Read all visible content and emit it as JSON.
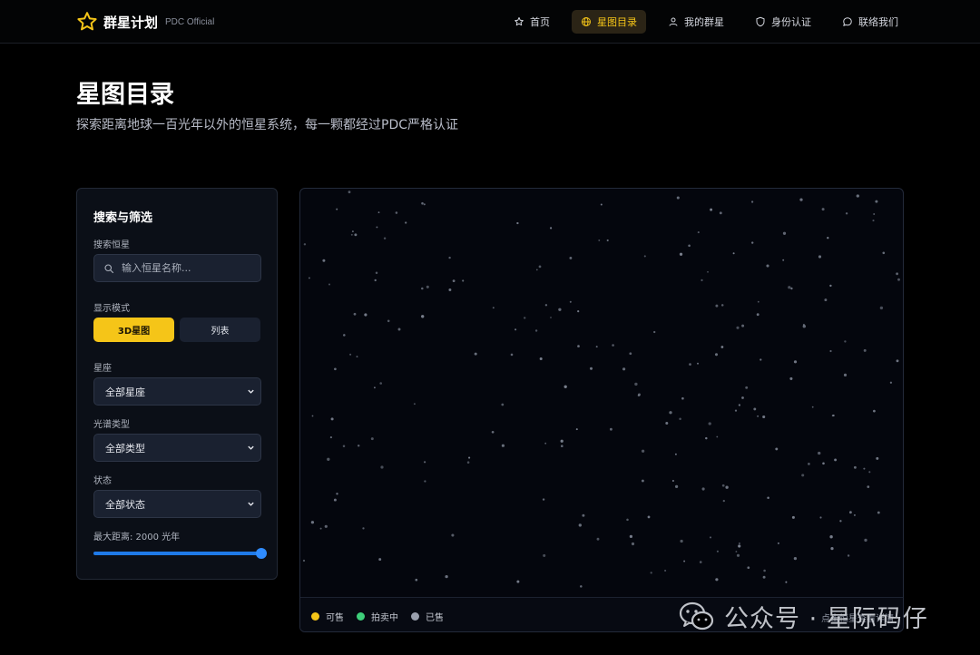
{
  "brand": {
    "name": "群星计划",
    "sub": "PDC Official",
    "accent": "#f5c518"
  },
  "nav": {
    "items": [
      {
        "label": "首页",
        "icon": "star-outline-icon",
        "active": false
      },
      {
        "label": "星图目录",
        "icon": "globe-icon",
        "active": true
      },
      {
        "label": "我的群星",
        "icon": "user-icon",
        "active": false
      },
      {
        "label": "身份认证",
        "icon": "shield-icon",
        "active": false
      },
      {
        "label": "联络我们",
        "icon": "chat-icon",
        "active": false
      }
    ]
  },
  "header": {
    "title": "星图目录",
    "subtitle": "探索距离地球一百光年以外的恒星系统，每一颗都经过PDC严格认证"
  },
  "filters": {
    "title": "搜索与筛选",
    "search_label": "搜索恒星",
    "search_placeholder": "输入恒星名称...",
    "mode_label": "显示模式",
    "mode_3d": "3D星图",
    "mode_list": "列表",
    "constellation_label": "星座",
    "constellation_value": "全部星座",
    "spectral_label": "光谱类型",
    "spectral_value": "全部类型",
    "status_label": "状态",
    "status_value": "全部状态",
    "distance_label": "最大距离: 2000 光年",
    "distance_fraction": 1.0
  },
  "legend": {
    "items": [
      {
        "label": "可售",
        "color": "#f5c518"
      },
      {
        "label": "拍卖中",
        "color": "#3ecf7a"
      },
      {
        "label": "已售",
        "color": "#9aa0ad"
      }
    ],
    "hint": "点击恒星查看详情"
  },
  "watermark": {
    "text": "公众号 · 星际码仔"
  }
}
